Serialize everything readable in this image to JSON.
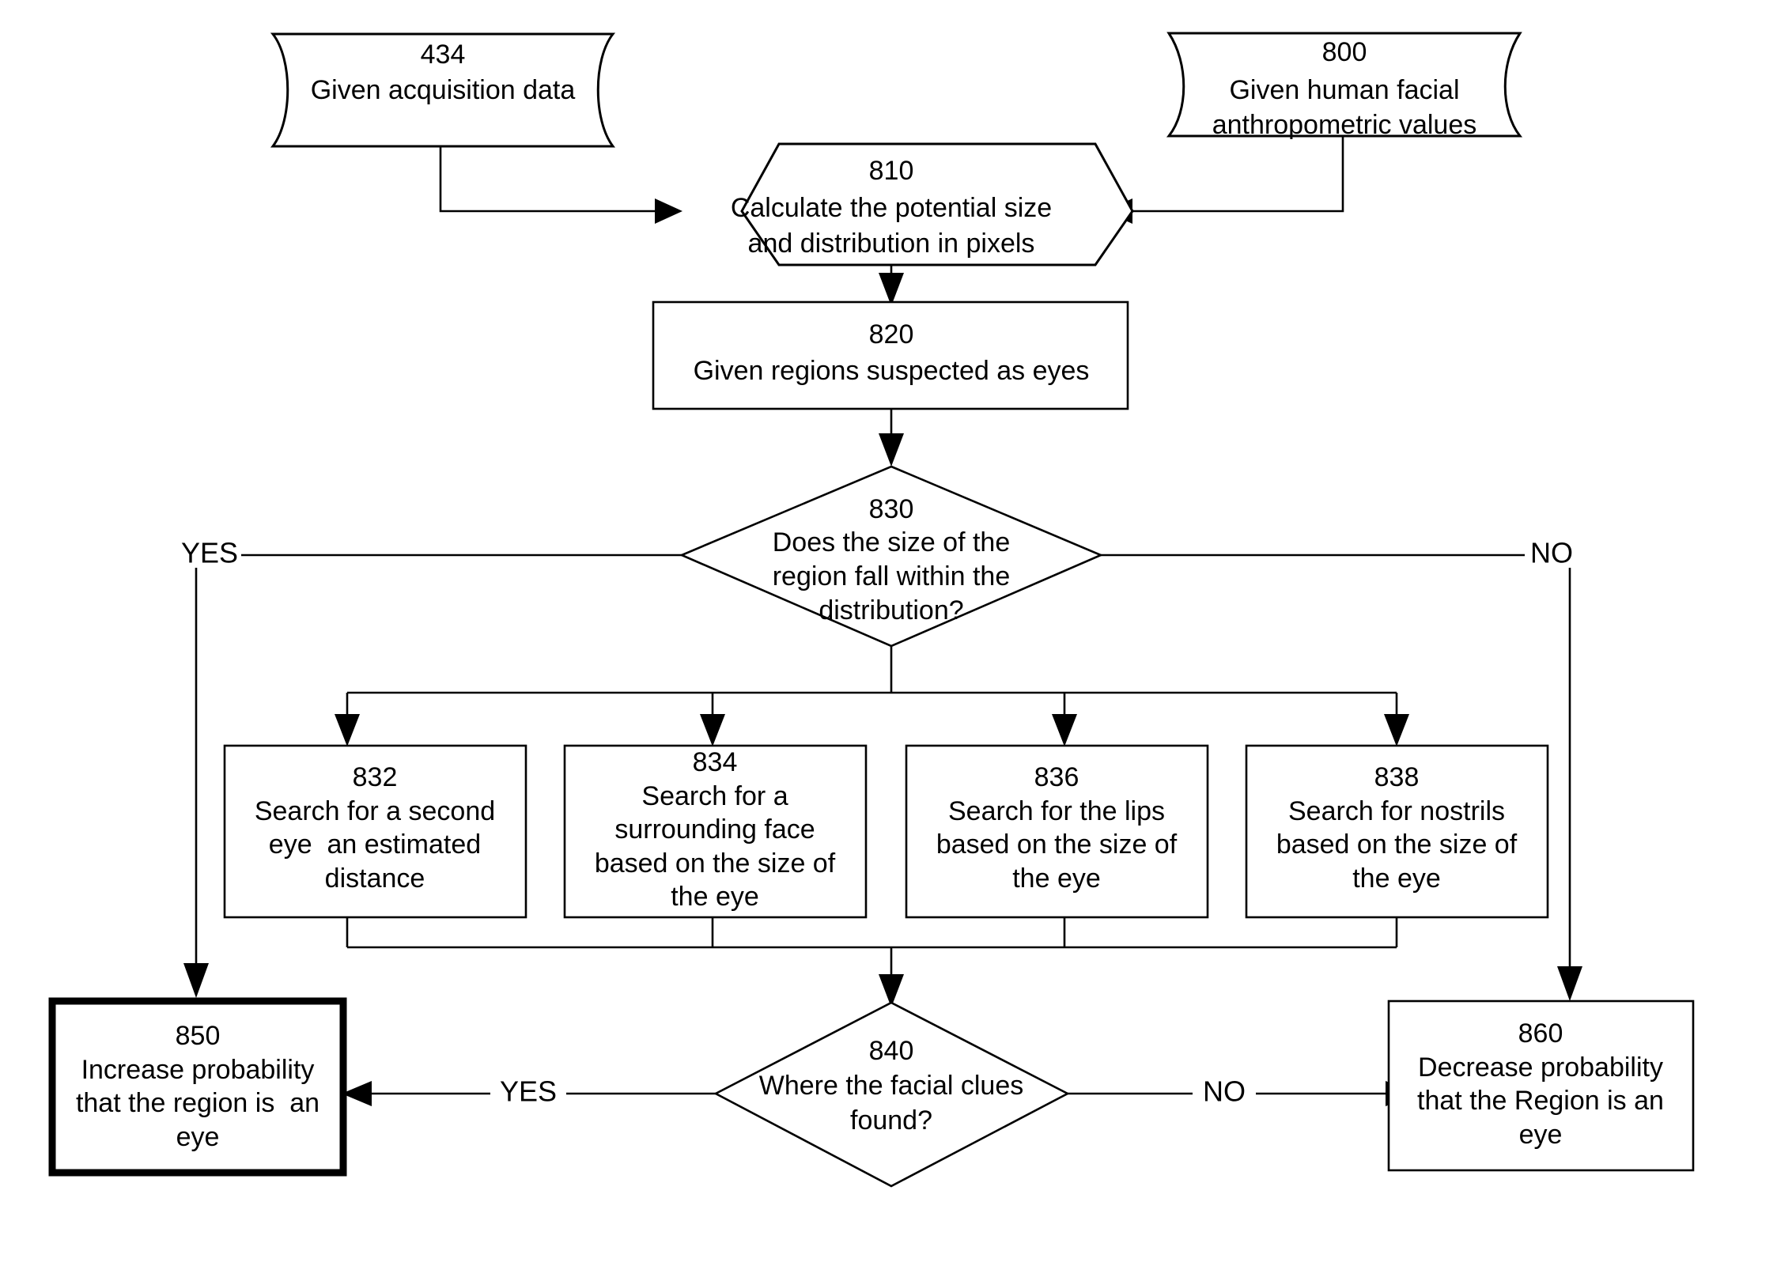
{
  "diagram": {
    "title": "Eye region verification flowchart",
    "background_color": "#ffffff",
    "line_color": "#000000",
    "nodes": {
      "n434": {
        "id": "434",
        "shape": "data-tape",
        "lines": [
          "434",
          "Given acquisition data"
        ]
      },
      "n800": {
        "id": "800",
        "shape": "data-tape",
        "lines": [
          "800",
          "Given human facial",
          "anthropometric values"
        ]
      },
      "n810": {
        "id": "810",
        "shape": "hexagon",
        "lines": [
          "810",
          "Calculate the potential size",
          "and distribution in pixels"
        ]
      },
      "n820": {
        "id": "820",
        "shape": "rectangle",
        "lines": [
          "820",
          "Given regions suspected as eyes"
        ]
      },
      "n830": {
        "id": "830",
        "shape": "diamond",
        "lines": [
          "830",
          "Does the size of the",
          "region fall within the",
          "distribution?"
        ]
      },
      "n832": {
        "id": "832",
        "shape": "rectangle",
        "lines": [
          "832",
          "Search for a second",
          "eye  an estimated",
          "distance"
        ]
      },
      "n834": {
        "id": "834",
        "shape": "rectangle",
        "lines": [
          "834",
          "Search for a",
          "surrounding face",
          "based on the size of",
          "the eye"
        ]
      },
      "n836": {
        "id": "836",
        "shape": "rectangle",
        "lines": [
          "836",
          "Search for the lips",
          "based on the size of",
          "the eye"
        ]
      },
      "n838": {
        "id": "838",
        "shape": "rectangle",
        "lines": [
          "838",
          "Search for nostrils",
          "based on the size of",
          "the eye"
        ]
      },
      "n840": {
        "id": "840",
        "shape": "diamond",
        "lines": [
          "840",
          "Where the facial clues",
          "found?"
        ]
      },
      "n850": {
        "id": "850",
        "shape": "rectangle-bold",
        "lines": [
          "850",
          "Increase probability",
          "that the region is  an",
          "eye"
        ]
      },
      "n860": {
        "id": "860",
        "shape": "rectangle",
        "lines": [
          "860",
          "Decrease probability",
          "that the Region is an",
          "eye"
        ]
      }
    },
    "edge_labels": {
      "yes_830": "YES",
      "no_830": "NO",
      "yes_840": "YES",
      "no_840": "NO"
    }
  }
}
